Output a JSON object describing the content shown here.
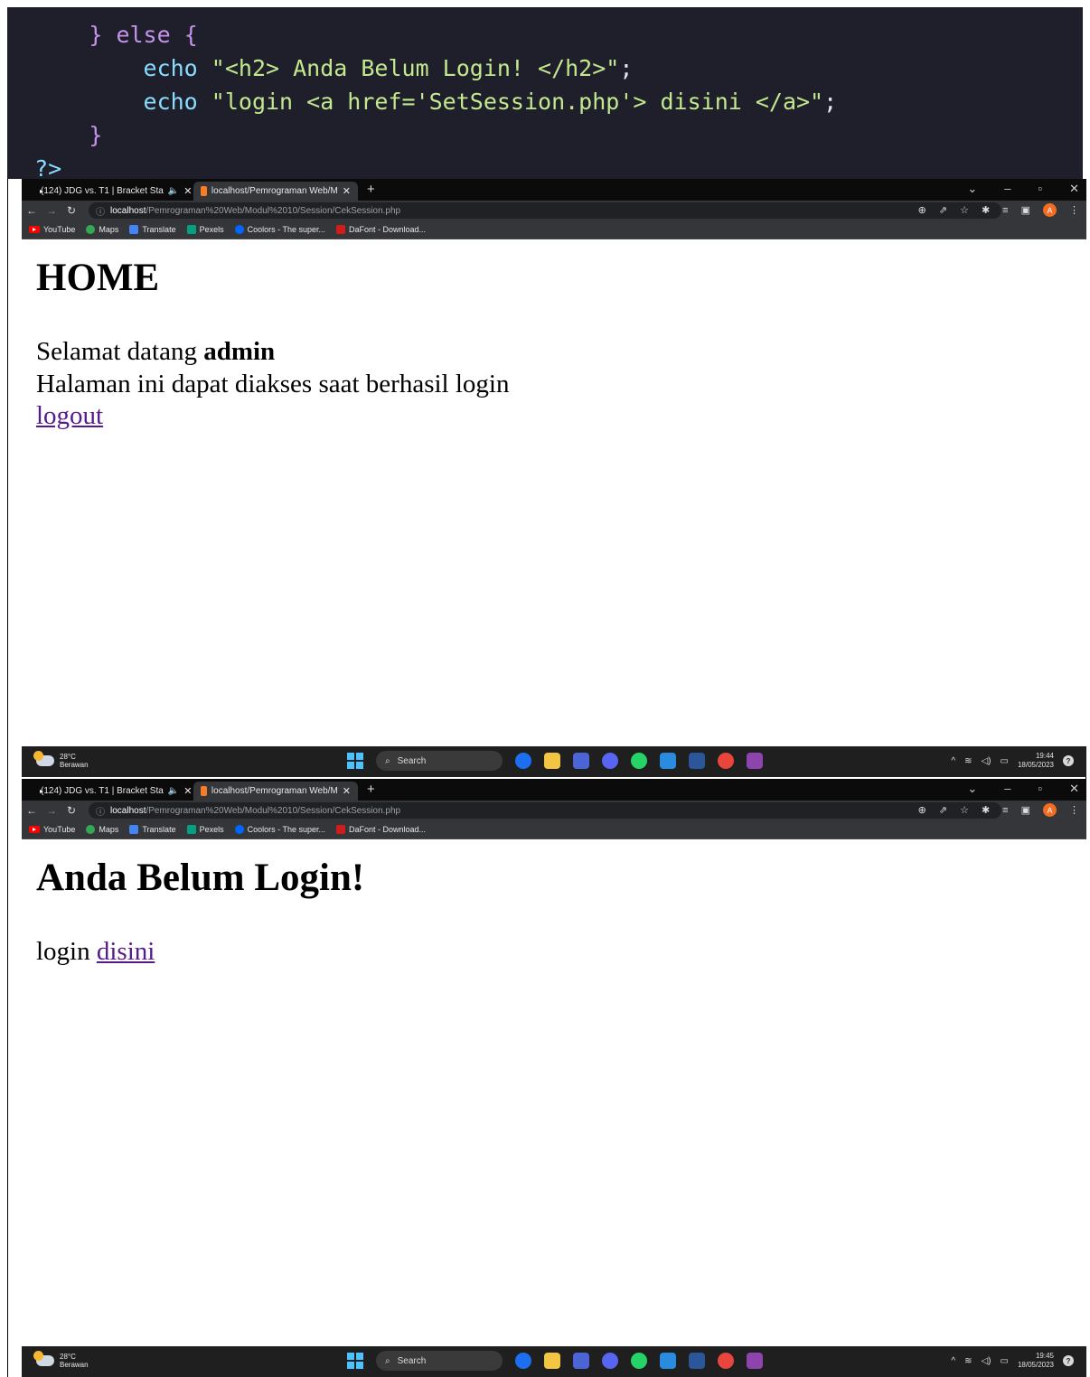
{
  "code": {
    "line1_close_brace": "}",
    "line1_else": "else",
    "line1_open_brace": "{",
    "line2_echo": "echo",
    "line2_string": "\"<h2> Anda Belum Login! </h2>\"",
    "line2_semi": ";",
    "line3_echo": "echo",
    "line3_string": "\"login <a href='SetSession.php'> disini </a>\"",
    "line3_semi": ";",
    "line4_close_brace": "}",
    "line5_php_close": "?>"
  },
  "browser": {
    "tab1_title": "(124) JDG vs. T1 | Bracket Sta",
    "tab1_audio": "🔈",
    "tab2_title": "localhost/Pemrograman Web/M",
    "tab_close": "✕",
    "new_tab": "+",
    "url_host": "localhost",
    "url_path": "/Pemrograman%20Web/Modul%2010/Session/CekSession.php",
    "profile_initial": "A",
    "bookmarks": [
      "YouTube",
      "Maps",
      "Translate",
      "Pexels",
      "Coolors - The super...",
      "DaFont - Download..."
    ]
  },
  "page1": {
    "title": "HOME",
    "welcome_prefix": "Selamat datang",
    "username": "admin",
    "message": "Halaman ini dapat diakses saat berhasil login",
    "logout_link": "logout"
  },
  "page2": {
    "title": "Anda Belum Login!",
    "login_prefix": "login",
    "login_link": "disini"
  },
  "taskbar": {
    "temperature": "28°C",
    "weather": "Berawan",
    "search_label": "Search",
    "time1": "19:44",
    "time2": "19:45",
    "date": "18/05/2023"
  },
  "colors": {
    "code_bg": "#1e1f2b",
    "link": "#551a8b",
    "browser_dark": "#35363a",
    "taskbar": "#1f1f1f"
  }
}
